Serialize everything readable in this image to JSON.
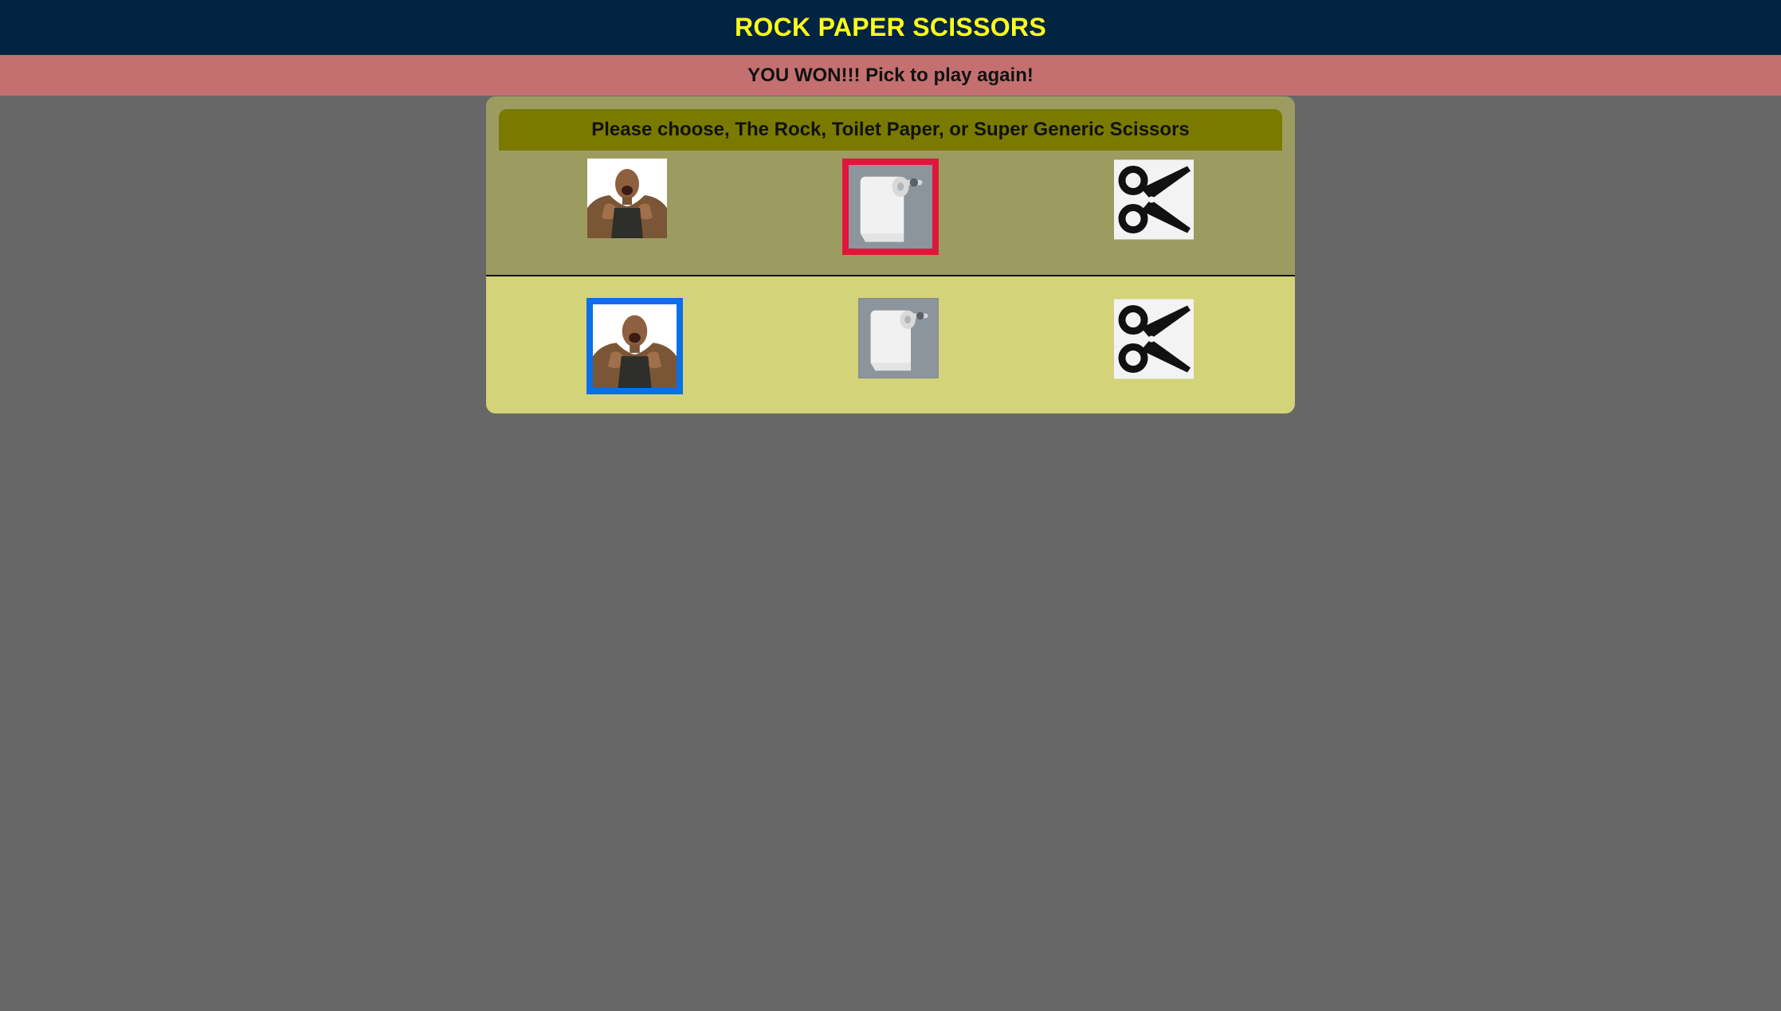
{
  "header": {
    "title": "ROCK PAPER SCISSORS",
    "title_color": "#ffff1a",
    "background": "#012442"
  },
  "status": {
    "message": "YOU WON!!! Pick to play again!",
    "background": "#c47070"
  },
  "board": {
    "prompt": "Please choose, The Rock, Toilet Paper, or Super Generic Scissors",
    "player_choices": [
      {
        "id": "rock",
        "icon": "the-rock-photo-icon",
        "selected": false
      },
      {
        "id": "paper",
        "icon": "toilet-paper-icon",
        "selected": true,
        "highlight_color": "#e0163a"
      },
      {
        "id": "scissors",
        "icon": "scissors-icon",
        "selected": false
      }
    ],
    "computer_choices": [
      {
        "id": "rock",
        "icon": "the-rock-photo-icon",
        "selected": true,
        "highlight_color": "#0a6fe8"
      },
      {
        "id": "paper",
        "icon": "toilet-paper-icon",
        "selected": false
      },
      {
        "id": "scissors",
        "icon": "scissors-icon",
        "selected": false
      }
    ],
    "colors": {
      "player_area": "#9c9c61",
      "computer_area": "#d3d37a",
      "prompt_bar": "#7a7a00",
      "page_background": "#676767"
    }
  }
}
